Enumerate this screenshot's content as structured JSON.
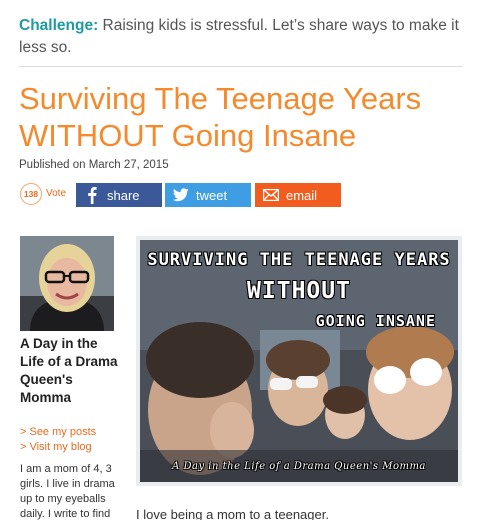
{
  "challenge": {
    "label": "Challenge:",
    "text": "Raising kids is stressful. Let’s share ways to make it less so."
  },
  "article": {
    "title": "Surviving The Teenage Years WITHOUT Going Insane",
    "published": "Published on March 27, 2015",
    "intro": "I love being a mom to a teenager."
  },
  "vote": {
    "count": "138",
    "label": "Vote"
  },
  "share_buttons": [
    {
      "label": "share",
      "icon": "facebook-icon",
      "color": "#3b5998"
    },
    {
      "label": "tweet",
      "icon": "twitter-icon",
      "color": "#3f9ee3"
    },
    {
      "label": "email",
      "icon": "email-icon",
      "color": "#f25d1f"
    }
  ],
  "author": {
    "name": "A Day in the Life of a Drama Queen's Momma",
    "links": [
      "> See my posts",
      "> Visit my blog"
    ],
    "bio": "I am a mom of 4, 3 girls. I live in drama up to my eyeballs daily. I write to find"
  },
  "hero_image": {
    "caption_line1": "SURVIVING THE TEENAGE YEARS",
    "caption_line2": "WITHOUT",
    "caption_line3": "GOING INSANE",
    "watermark": "A Day in the Life of a Drama Queen's Momma"
  },
  "colors": {
    "accent_orange": "#f58a2c",
    "challenge_teal": "#1f9aa0"
  }
}
